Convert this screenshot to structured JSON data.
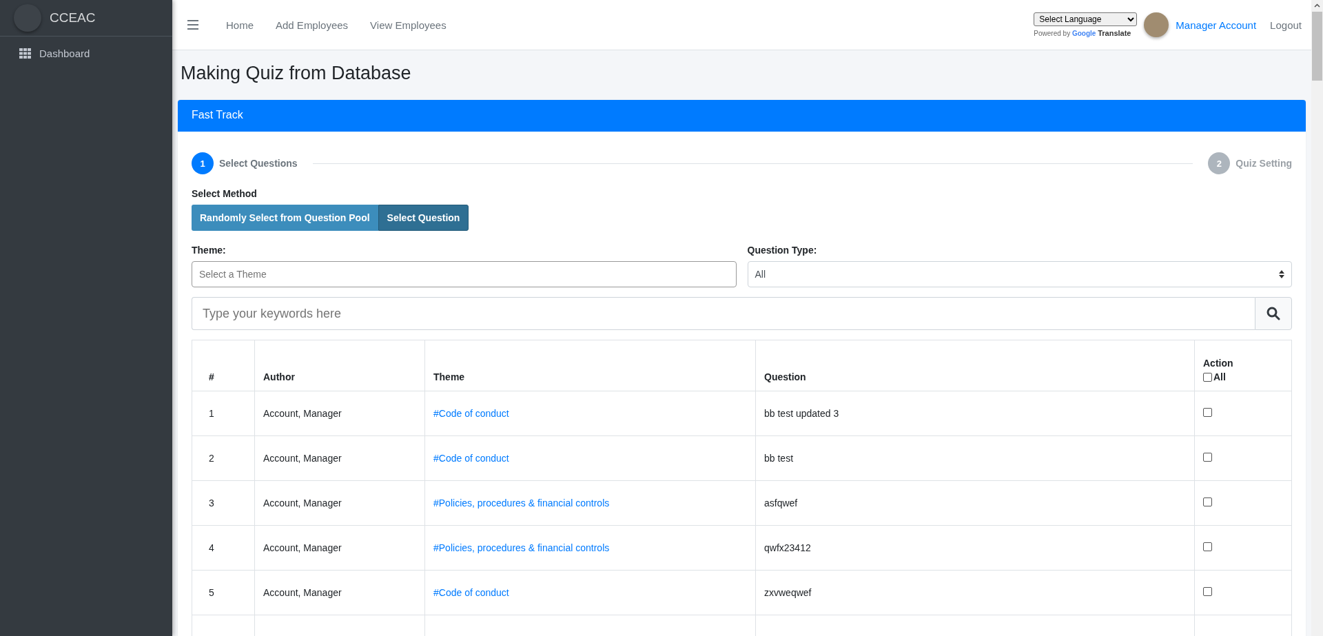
{
  "sidebar": {
    "brand": "CCEAC",
    "items": [
      {
        "label": "Dashboard",
        "selected": false
      }
    ]
  },
  "topnav": {
    "links": [
      "Home",
      "Add Employees",
      "View Employees"
    ],
    "language_select": "Select Language",
    "powered_by": "Powered by",
    "google": "Google",
    "translate": "Translate",
    "account": "Manager Account",
    "logout": "Logout"
  },
  "page_title": "Making Quiz from Database",
  "card": {
    "header": "Fast Track",
    "steps": [
      {
        "number": "1",
        "label": "Select Questions",
        "active": true
      },
      {
        "number": "2",
        "label": "Quiz Setting",
        "active": false
      }
    ],
    "method_label": "Select Method",
    "methods": [
      {
        "label": "Randomly Select from Question Pool",
        "selected": false
      },
      {
        "label": "Select Question",
        "selected": true
      }
    ],
    "theme": {
      "label": "Theme:",
      "placeholder": "Select a Theme"
    },
    "question_type": {
      "label": "Question Type:",
      "value": "All"
    },
    "search": {
      "placeholder": "Type your keywords here"
    },
    "table": {
      "columns": [
        "#",
        "Author",
        "Theme",
        "Question",
        "Action"
      ],
      "select_all": {
        "label": "All",
        "checked": false
      },
      "rows": [
        {
          "number": "1",
          "author": "Account, Manager",
          "theme": "#Code of conduct",
          "question": "bb test updated 3",
          "checked": false
        },
        {
          "number": "2",
          "author": "Account, Manager",
          "theme": "#Code of conduct",
          "question": "bb test",
          "checked": false
        },
        {
          "number": "3",
          "author": "Account, Manager",
          "theme": "#Policies, procedures & financial controls",
          "question": "asfqwef",
          "checked": false
        },
        {
          "number": "4",
          "author": "Account, Manager",
          "theme": "#Policies, procedures & financial controls",
          "question": "qwfx23412",
          "checked": false
        },
        {
          "number": "5",
          "author": "Account, Manager",
          "theme": "#Code of conduct",
          "question": "zxvweqwef",
          "checked": false
        }
      ]
    }
  }
}
